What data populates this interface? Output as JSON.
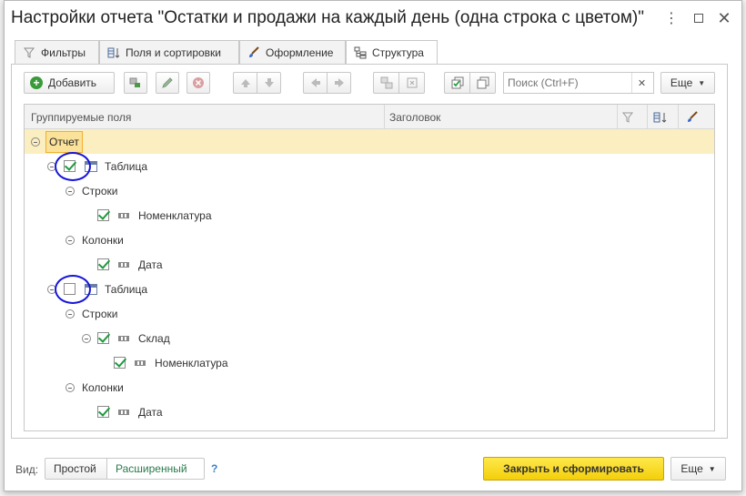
{
  "window": {
    "title": "Настройки отчета \"Остатки и продажи на каждый день (одна строка с цветом)\""
  },
  "tabs": [
    {
      "label": "Фильтры",
      "icon": "filter-icon"
    },
    {
      "label": "Поля и сортировки",
      "icon": "fields-sort-icon"
    },
    {
      "label": "Оформление",
      "icon": "brush-icon"
    },
    {
      "label": "Структура",
      "icon": "structure-icon",
      "active": true
    }
  ],
  "toolbar": {
    "add_label": "Добавить",
    "search_placeholder": "Поиск (Ctrl+F)",
    "more_label": "Еще"
  },
  "grid": {
    "columns": [
      "Группируемые поля",
      "Заголовок"
    ],
    "rows": [
      {
        "label": "Отчет",
        "level": 0,
        "expandable": true,
        "selected": true
      },
      {
        "label": "Таблица",
        "level": 1,
        "expandable": true,
        "checkbox": true,
        "checked": true,
        "icon": "table-icon",
        "highlighted": true
      },
      {
        "label": "Строки",
        "level": 2,
        "expandable": true
      },
      {
        "label": "Номенклатура",
        "level": 3,
        "checkbox": true,
        "checked": true,
        "icon": "field-icon"
      },
      {
        "label": "Колонки",
        "level": 2,
        "expandable": true
      },
      {
        "label": "Дата",
        "level": 3,
        "checkbox": true,
        "checked": true,
        "icon": "field-icon"
      },
      {
        "label": "Таблица",
        "level": 1,
        "expandable": true,
        "checkbox": true,
        "checked": false,
        "icon": "table-icon",
        "highlighted": true
      },
      {
        "label": "Строки",
        "level": 2,
        "expandable": true
      },
      {
        "label": "Склад",
        "level": 3,
        "expandable": true,
        "checkbox": true,
        "checked": true,
        "icon": "field-icon"
      },
      {
        "label": "Номенклатура",
        "level": 4,
        "checkbox": true,
        "checked": true,
        "icon": "field-icon"
      },
      {
        "label": "Колонки",
        "level": 2,
        "expandable": true
      },
      {
        "label": "Дата",
        "level": 3,
        "checkbox": true,
        "checked": true,
        "icon": "field-icon"
      }
    ]
  },
  "footer": {
    "view_label": "Вид:",
    "simple_label": "Простой",
    "extended_label": "Расширенный",
    "help_label": "?",
    "primary_label": "Закрыть и сформировать",
    "more_label": "Еще"
  },
  "colors": {
    "primary_button": "#f3cf0a",
    "selected_row": "#fbeec0",
    "highlight_circle": "#1616d8",
    "check": "#1c9a3c"
  }
}
